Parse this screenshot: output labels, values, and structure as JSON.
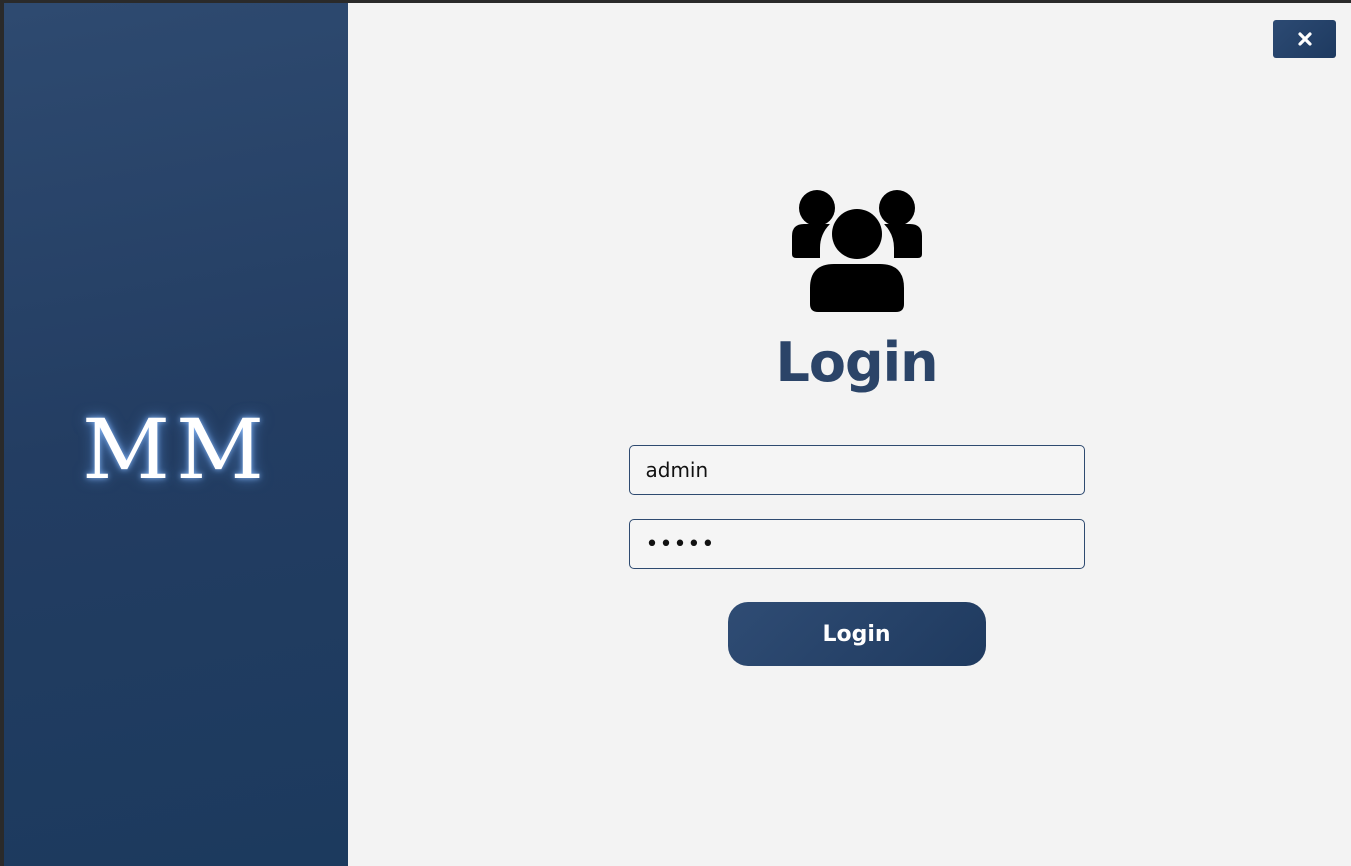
{
  "window": {
    "close_icon": "close-icon"
  },
  "side_panel": {
    "brand_text": "MM"
  },
  "login": {
    "users_icon": "users-icon",
    "title": "Login",
    "username_value": "admin",
    "password_value": "•••••",
    "button_label": "Login"
  },
  "colors": {
    "primary": "#2b4468",
    "side_panel": "#233d62",
    "background": "#f3f3f3",
    "brand_glow": "#8cbeff"
  }
}
